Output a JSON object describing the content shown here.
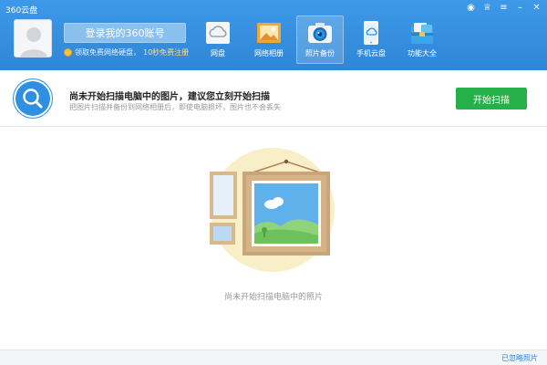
{
  "app": {
    "title": "360云盘"
  },
  "window_controls": {
    "skin": "◉",
    "shirt": "♕",
    "menu": "≡",
    "minimize": "–",
    "close": "✕"
  },
  "account": {
    "login_label": "登录我的360账号",
    "promo_text": "领取免费网络硬盘，",
    "promo_highlight": "10秒免费注册"
  },
  "nav": {
    "items": [
      {
        "label": "网盘",
        "icon": "cloud-drive-icon",
        "active": false
      },
      {
        "label": "网络相册",
        "icon": "photo-album-icon",
        "active": false
      },
      {
        "label": "照片备份",
        "icon": "camera-icon",
        "active": true
      },
      {
        "label": "手机云盘",
        "icon": "phone-cloud-icon",
        "active": false
      },
      {
        "label": "功能大全",
        "icon": "toolbox-icon",
        "active": false
      }
    ]
  },
  "info": {
    "title": "尚未开始扫描电脑中的图片，建议您立刻开始扫描",
    "subtitle": "把图片扫描并备份到网络相册后，即使电脑损坏，图片也不会丢失",
    "scan_button": "开始扫描"
  },
  "empty_state": {
    "text": "尚未开始扫描电脑中的照片"
  },
  "footer": {
    "ignored_link": "已忽略照片"
  },
  "colors": {
    "header": "#2f86d6",
    "accent_green": "#26b04a",
    "accent_blue": "#2f8fe0"
  }
}
